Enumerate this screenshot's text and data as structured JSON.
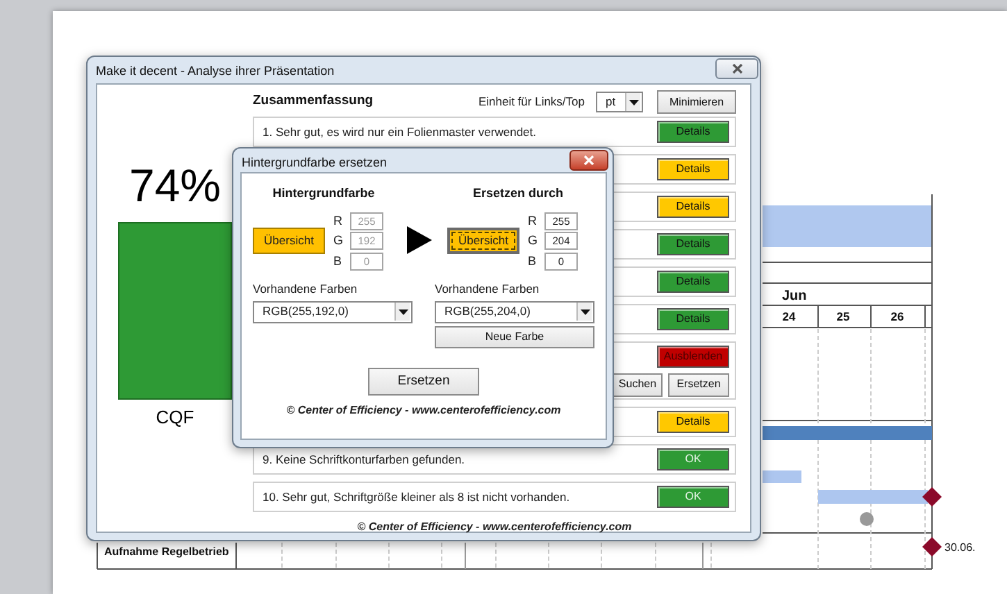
{
  "slide": {
    "gantt": {
      "month": "Jun",
      "days": [
        "24",
        "25",
        "26"
      ],
      "milestone_row": {
        "label": "Aufnahme Regelbetrieb",
        "date": "30.06."
      }
    }
  },
  "main_window": {
    "title": "Make it decent - Analyse ihrer Präsentation",
    "score": "74%",
    "score_label": "CQF",
    "summary_title": "Zusammenfassung",
    "unit_label": "Einheit für Links/Top",
    "unit_value": "pt",
    "minimize_button": "Minimieren",
    "checks": [
      {
        "text": "1. Sehr gut, es wird nur ein Folienmaster verwendet.",
        "button": "Details",
        "color": "#2e9a35",
        "disabled": false
      },
      {
        "button": "Details",
        "color": "#ffc800",
        "disabled": false
      },
      {
        "button": "Details",
        "color": "#ffc800",
        "disabled": false
      },
      {
        "button": "Details",
        "color": "#2e9a35",
        "disabled": false
      },
      {
        "button": "Details",
        "color": "#2e9a35",
        "disabled": false
      },
      {
        "button": "Details",
        "color": "#2e9a35",
        "disabled": false
      },
      {
        "button": "Ausblenden",
        "color": "#c00000",
        "disabled": false,
        "extra_buttons": [
          "Suchen",
          "Ersetzen"
        ]
      },
      {
        "button": "Details",
        "color": "#ffc800",
        "disabled": false
      },
      {
        "text": "9. Keine Schriftkonturfarben gefunden.",
        "button": "OK",
        "color": "#2e9a35",
        "disabled": true
      },
      {
        "text": "10. Sehr gut, Schriftgröße kleiner als 8 ist nicht vorhanden.",
        "button": "OK",
        "color": "#2e9a35",
        "disabled": true
      }
    ],
    "footer": "© Center of Efficiency - www.centerofefficiency.com"
  },
  "dialog": {
    "title": "Hintergrundfarbe ersetzen",
    "source": {
      "heading": "Hintergrundfarbe",
      "button": "Übersicht",
      "focused": false,
      "channels": [
        {
          "label": "R",
          "value": "255",
          "disabled": true
        },
        {
          "label": "G",
          "value": "192",
          "disabled": true
        },
        {
          "label": "B",
          "value": "0",
          "disabled": true
        }
      ],
      "existing_label": "Vorhandene Farben",
      "existing_value": "RGB(255,192,0)"
    },
    "target": {
      "heading": "Ersetzen durch",
      "button": "Übersicht",
      "focused": true,
      "channels": [
        {
          "label": "R",
          "value": "255",
          "disabled": false
        },
        {
          "label": "G",
          "value": "204",
          "disabled": false
        },
        {
          "label": "B",
          "value": "0",
          "disabled": false
        }
      ],
      "existing_label": "Vorhandene Farben",
      "existing_value": "RGB(255,204,0)",
      "new_color_button": "Neue Farbe"
    },
    "replace_button": "Ersetzen",
    "footer": "© Center of Efficiency - www.centerofefficiency.com"
  }
}
